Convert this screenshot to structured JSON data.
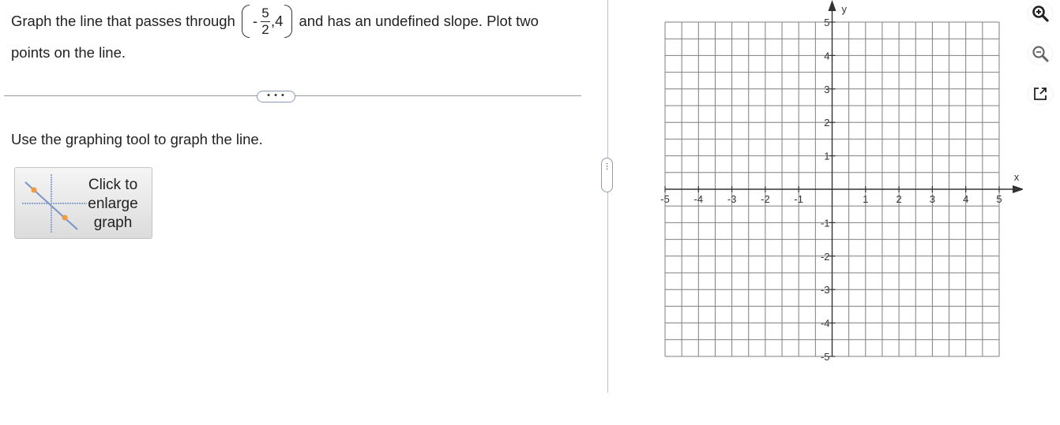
{
  "question": {
    "text_before": "Graph the line that passes through",
    "point": {
      "sign": "-",
      "numerator": "5",
      "denominator": "2",
      "separator": ",",
      "y": "4"
    },
    "text_after": "and has an undefined slope. Plot two",
    "text_line2": "points on the line."
  },
  "more_button": {
    "label": "• • •"
  },
  "instruction": "Use the graphing tool to graph the line.",
  "enlarge_button": {
    "line1": "Click to",
    "line2": "enlarge",
    "line3": "graph"
  },
  "splitter": {
    "label": "⋮"
  },
  "graph": {
    "x_axis_label": "x",
    "y_axis_label": "y",
    "x_range": [
      -5,
      5
    ],
    "y_range": [
      -5,
      5
    ],
    "minor_step": 0.5,
    "x_tick_labels": [
      "-5",
      "-4",
      "-3",
      "-2",
      "-1",
      "1",
      "2",
      "3",
      "4",
      "5"
    ],
    "y_tick_labels": [
      "5",
      "4",
      "3",
      "2",
      "1",
      "-1",
      "-2",
      "-3",
      "-4",
      "-5"
    ],
    "grid": true
  },
  "toolbar": {
    "zoom_in_icon": "zoom-in-icon",
    "zoom_out_icon": "zoom-out-icon",
    "popout_icon": "popout-icon"
  }
}
